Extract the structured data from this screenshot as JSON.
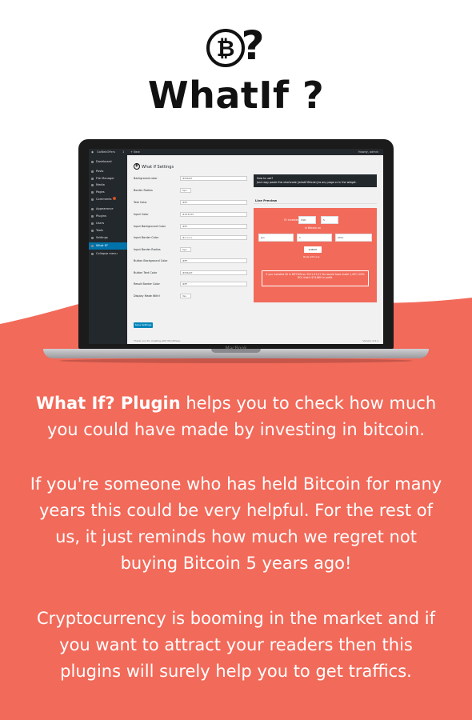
{
  "brand": {
    "title": "WhatIf ?",
    "logo_symbol": "₿",
    "logo_question": "?",
    "accent_color": "#f26a5a",
    "text_color": "#111111"
  },
  "screen": {
    "adminbar": {
      "site_name": "GoWebOffers",
      "comments_count": "1",
      "new_label": "+ New",
      "greeting": "Howdy, admin"
    },
    "sidebar": [
      {
        "label": "Dashboard",
        "active": false,
        "badge": false
      },
      {
        "label": "Posts",
        "active": false,
        "badge": false
      },
      {
        "label": "File Manager",
        "active": false,
        "badge": false
      },
      {
        "label": "Media",
        "active": false,
        "badge": false
      },
      {
        "label": "Pages",
        "active": false,
        "badge": false
      },
      {
        "label": "Comments",
        "active": false,
        "badge": true
      },
      {
        "label": "Appearance",
        "active": false,
        "badge": false
      },
      {
        "label": "Plugins",
        "active": false,
        "badge": false
      },
      {
        "label": "Users",
        "active": false,
        "badge": false
      },
      {
        "label": "Tools",
        "active": false,
        "badge": false
      },
      {
        "label": "Settings",
        "active": false,
        "badge": false
      },
      {
        "label": "What If?",
        "active": true,
        "badge": false
      },
      {
        "label": "Collapse menu",
        "active": false,
        "badge": false
      }
    ],
    "settings_title": "What If Settings",
    "fields": [
      {
        "label": "Background color",
        "value": "#f26a5f",
        "kind": "input"
      },
      {
        "label": "Border Radius",
        "value": "5px",
        "kind": "select"
      },
      {
        "label": "Text Color",
        "value": "#fff",
        "kind": "input"
      },
      {
        "label": "Input Color",
        "value": "#333333",
        "kind": "input"
      },
      {
        "label": "Input Background Color",
        "value": "#fff",
        "kind": "input"
      },
      {
        "label": "Input Border Color",
        "value": "#cccccc",
        "kind": "input"
      },
      {
        "label": "Input Border Radius",
        "value": "5px",
        "kind": "select"
      },
      {
        "label": "Button Background Color",
        "value": "#fff",
        "kind": "input"
      },
      {
        "label": "Button Text Color",
        "value": "#f26a5f",
        "kind": "input"
      },
      {
        "label": "Result Border Color",
        "value": "#fff",
        "kind": "input"
      },
      {
        "label": "Display Made With!",
        "value": "Yes",
        "kind": "select"
      }
    ],
    "save_label": "Save Settings",
    "footer_left": "Thank you for creating with WordPress.",
    "footer_right": "Version 4.9.1",
    "howto_title": "How to use?",
    "howto_text": "Just copy paste this shortcode [whatif Bitcoin] to any page or in the widget.",
    "live_preview_title": "Live Preview",
    "preview": {
      "if_invested": "If I invested",
      "currency": "USD",
      "amount": "5",
      "in_bitcoin": "in Bitcoin on",
      "month": "Jan",
      "day": "1",
      "year": "2011",
      "button": "SUBMIT",
      "made_with": "Made with Love",
      "result": "If you invested $5 in BITCOIN on 2011-01-01 You would have made 1,497,105% ROI, that's $74,860 in profit."
    },
    "laptop_brand": "MacBook"
  },
  "copy": {
    "p1_bold": "What If? Plugin",
    "p1_rest": " helps you to check how much you could have made by investing in bitcoin.",
    "p2": "If you're someone who has held Bitcoin for many years this could be very helpful. For the rest of us, it just reminds how much we regret not buying Bitcoin 5 years ago!",
    "p3": "Cryptocurrency is booming in the market and if you want to attract your readers then this plugins will surely help you to get traffics."
  }
}
